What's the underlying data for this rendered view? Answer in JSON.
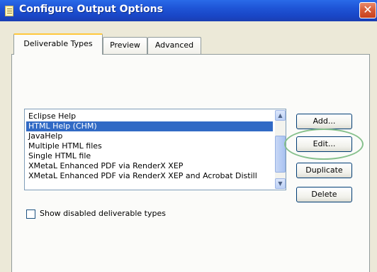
{
  "window": {
    "title": "Configure Output Options",
    "close_symbol": "✕",
    "title_icon": "document-icon"
  },
  "tabs": [
    {
      "label": "Deliverable Types",
      "active": true
    },
    {
      "label": "Preview",
      "active": false
    },
    {
      "label": "Advanced",
      "active": false
    }
  ],
  "deliverables": {
    "items": [
      {
        "label": "Eclipse Help",
        "selected": false
      },
      {
        "label": "HTML Help (CHM)",
        "selected": true
      },
      {
        "label": "JavaHelp",
        "selected": false
      },
      {
        "label": "Multiple HTML files",
        "selected": false
      },
      {
        "label": "Single HTML file",
        "selected": false
      },
      {
        "label": "XMetaL Enhanced PDF via RenderX XEP",
        "selected": false
      },
      {
        "label": "XMetaL Enhanced PDF via RenderX XEP and Acrobat Distill",
        "selected": false
      }
    ],
    "scroll_up_symbol": "▲",
    "scroll_down_symbol": "▼"
  },
  "buttons": {
    "add": "Add...",
    "edit": "Edit...",
    "duplicate": "Duplicate",
    "delete": "Delete"
  },
  "options": {
    "show_disabled_label": "Show disabled deliverable types",
    "show_disabled_checked": false
  },
  "colors": {
    "selection": "#316ac5",
    "highlight_ellipse": "#86c08c",
    "active_tab_accent": "#ffc83c"
  }
}
